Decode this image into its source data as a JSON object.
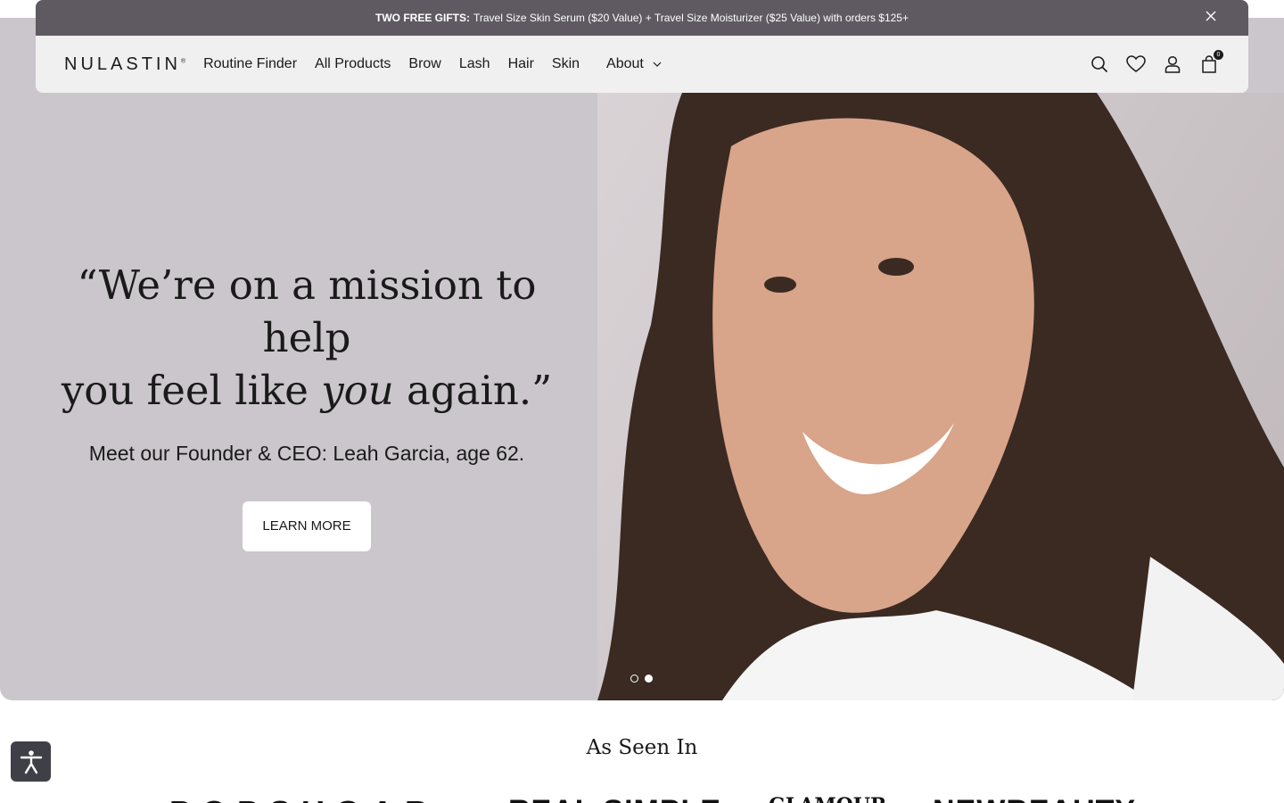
{
  "announcement": {
    "bold": "TWO FREE GIFTS:",
    "text": "Travel Size Skin Serum ($20 Value) + Travel Size Moisturizer ($25 Value) with orders $125+",
    "close_icon": "close-icon"
  },
  "header": {
    "logo": "NULASTIN",
    "nav": [
      "Routine Finder",
      "All Products",
      "Brow",
      "Lash",
      "Hair",
      "Skin"
    ],
    "about": "About",
    "icons": [
      "search-icon",
      "heart-icon",
      "user-icon",
      "bag-icon"
    ],
    "cart_count": "0"
  },
  "hero": {
    "headline_1": "“We’re on a mission to help",
    "headline_2_pre": "you feel like ",
    "headline_2_em": "you",
    "headline_2_post": " again.”",
    "subline": "Meet our Founder & CEO: Leah Garcia, age 62.",
    "cta": "LEARN MORE",
    "slides": 2,
    "active_slide": 2
  },
  "press": {
    "title": "As Seen In",
    "logos": [
      "POPSUGAR",
      "REAL SIMPLE",
      "GLAMOUR",
      "NEWBEAUTY"
    ]
  },
  "colors": {
    "hero_bg": "#cbc6cc",
    "announce_bg": "#5f5a62",
    "header_bg": "#f0f0f0"
  }
}
